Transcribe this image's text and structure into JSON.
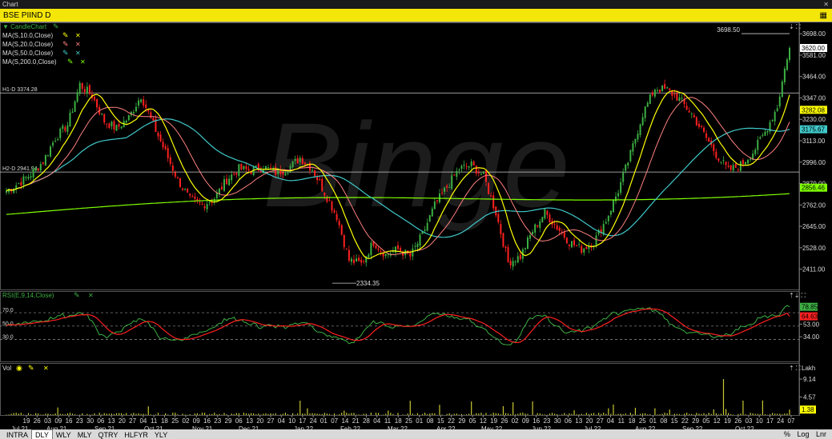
{
  "window": {
    "title": "Chart"
  },
  "symbol": {
    "label": "BSE PIIND D"
  },
  "indicators": [
    {
      "label": "CandleChart",
      "color": "#3cb043"
    },
    {
      "label": "MA(S,10.0,Close)",
      "color": "#ffff00"
    },
    {
      "label": "MA(S,20.0,Close)",
      "color": "#ff8080"
    },
    {
      "label": "MA(S,50.0,Close)",
      "color": "#40c8c8"
    },
    {
      "label": "MA(S,200.0,Close)",
      "color": "#7fff00"
    }
  ],
  "hlines": {
    "h1": "H1-D 3374.28",
    "h2": "H2-D 2941.94"
  },
  "annotations": {
    "high": "3698.50",
    "low": "2334.35",
    "watermark": "Binge"
  },
  "price_axis": {
    "ticks": [
      "3698.00",
      "3581.00",
      "3464.00",
      "3347.00",
      "3230.00",
      "3113.00",
      "2996.00",
      "2879.00",
      "2762.00",
      "2645.00",
      "2528.00",
      "2411.00"
    ],
    "badges": [
      {
        "text": "3620.00",
        "bg": "#ffffff",
        "fg": "#000000"
      },
      {
        "text": "3282.08",
        "bg": "#ffff00",
        "fg": "#000000"
      },
      {
        "text": "3175.67",
        "bg": "#40c8c8",
        "fg": "#000000"
      },
      {
        "text": "2856.46",
        "bg": "#7fff00",
        "fg": "#000000"
      }
    ]
  },
  "rsi": {
    "label": "RSI(E,9,14,Close)",
    "levels": [
      "70.0",
      "50.0",
      "30.0"
    ],
    "ticks": [
      "53.00",
      "34.00"
    ],
    "badges": [
      {
        "text": "78.85",
        "bg": "#3cb043",
        "fg": "#000000"
      },
      {
        "text": "64.63",
        "bg": "#ff2020",
        "fg": "#000000"
      }
    ]
  },
  "volume": {
    "label": "Vol",
    "unit": "Lakh",
    "ticks": [
      "9.14",
      "4.57"
    ],
    "badge": "1.38"
  },
  "date_axis": {
    "labels": [
      "19",
      "26",
      "03",
      "09",
      "16",
      "23",
      "30",
      "06",
      "13",
      "20",
      "27",
      "04",
      "11",
      "18",
      "25",
      "02",
      "09",
      "16",
      "23",
      "29",
      "06",
      "13",
      "20",
      "27",
      "04",
      "10",
      "17",
      "24",
      "01",
      "07",
      "14",
      "21",
      "28",
      "04",
      "11",
      "18",
      "25",
      "01",
      "08",
      "15",
      "22",
      "29",
      "05",
      "12",
      "19",
      "26",
      "02",
      "09",
      "16",
      "23",
      "30",
      "06",
      "13",
      "20",
      "27",
      "04",
      "11",
      "18",
      "25",
      "01",
      "08",
      "15",
      "22",
      "29",
      "05",
      "12",
      "19",
      "26",
      "03",
      "10",
      "17",
      "24",
      "07"
    ],
    "months": [
      "Jul 21",
      "Aug 21",
      "Sep 21",
      "Oct 21",
      "Nov 21",
      "Dec 21",
      "Jan 22",
      "Feb 22",
      "Mar 22",
      "Apr 22",
      "May 22",
      "Jun 22",
      "Jul 22",
      "Aug 22",
      "Sep 22",
      "Oct 22"
    ]
  },
  "timeframes": [
    "INTRA",
    "DLY",
    "WLY",
    "MLY",
    "QTRY",
    "HLFYR",
    "YLY"
  ],
  "timeframe_selected": "DLY",
  "bottom_right": {
    "pct": "%",
    "log": "Log",
    "lnr": "Lnr"
  },
  "chart_data": {
    "type": "candlestick",
    "title": "BSE PIIND D",
    "ylim": [
      2300,
      3760
    ],
    "y_ticks": [
      3698,
      3581,
      3464,
      3347,
      3230,
      3113,
      2996,
      2879,
      2762,
      2645,
      2528,
      2411
    ],
    "x_range": [
      "2021-07-19",
      "2022-11-07"
    ],
    "closes_weekly": [
      2840,
      2880,
      2930,
      3000,
      3130,
      3200,
      3420,
      3360,
      3220,
      3180,
      3240,
      3360,
      3200,
      3050,
      2900,
      2790,
      2760,
      2800,
      2900,
      2960,
      2950,
      2970,
      2940,
      2960,
      3020,
      2960,
      2830,
      2700,
      2460,
      2440,
      2560,
      2490,
      2520,
      2480,
      2600,
      2760,
      2860,
      2960,
      2980,
      2920,
      2720,
      2450,
      2480,
      2620,
      2720,
      2640,
      2560,
      2520,
      2560,
      2680,
      2840,
      3040,
      3260,
      3400,
      3390,
      3340,
      3260,
      3150,
      3040,
      2950,
      2980,
      3050,
      3160,
      3300,
      3640
    ],
    "series": [
      {
        "name": "MA(S,10.0,Close)",
        "last": 3282.08
      },
      {
        "name": "MA(S,20.0,Close)",
        "last": 3180
      },
      {
        "name": "MA(S,50.0,Close)",
        "last": 3175.67
      },
      {
        "name": "MA(S,200.0,Close)",
        "last": 2856.46
      }
    ],
    "last_close": 3620.0,
    "period_high": 3698.5,
    "period_low": 2334.35,
    "hlines": [
      3374.28,
      2941.94
    ],
    "rsi_last": 78.85,
    "rsi_signal_last": 64.63,
    "volume_max_lakh": 9.14,
    "volume_last_lakh": 1.38
  }
}
